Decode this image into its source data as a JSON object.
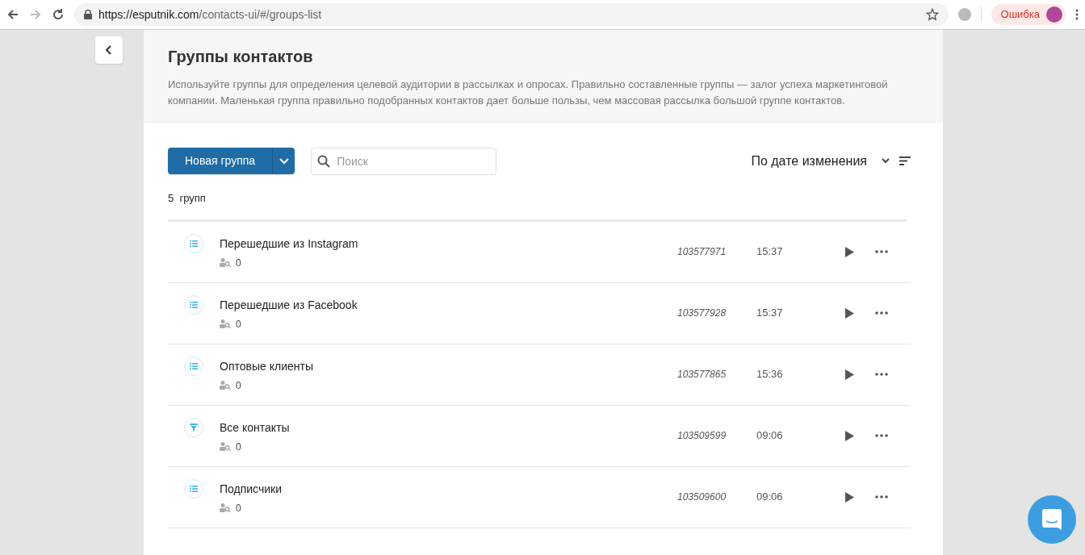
{
  "browser": {
    "url_host": "https://esputnik.com",
    "url_path": "/contacts-ui/#/groups-list",
    "error_badge": "Ошибка"
  },
  "header": {
    "title": "Группы контактов",
    "description": "Используйте группы для определения целевой аудитории в рассылках и опросах. Правильно составленные группы — залог успеха маркетинговой компании. Маленькая группа правильно подобранных контактов дает больше пользы, чем массовая рассылка большой группе контактов."
  },
  "toolbar": {
    "new_button": "Новая группа",
    "search": {
      "placeholder": "Поиск"
    },
    "sort": "По дате изменения"
  },
  "count": "5  групп",
  "groups": [
    {
      "kind": "list",
      "name": "Перешедшие из Instagram",
      "contacts": "0",
      "id": "103577971",
      "time": "15:37"
    },
    {
      "kind": "list",
      "name": "Перешедшие из Facebook",
      "contacts": "0",
      "id": "103577928",
      "time": "15:37"
    },
    {
      "kind": "list",
      "name": "Оптовые клиенты",
      "contacts": "0",
      "id": "103577865",
      "time": "15:36"
    },
    {
      "kind": "filter",
      "name": "Все контакты",
      "contacts": "0",
      "id": "103509599",
      "time": "09:06"
    },
    {
      "kind": "list",
      "name": "Подписчики",
      "contacts": "0",
      "id": "103509600",
      "time": "09:06"
    }
  ]
}
